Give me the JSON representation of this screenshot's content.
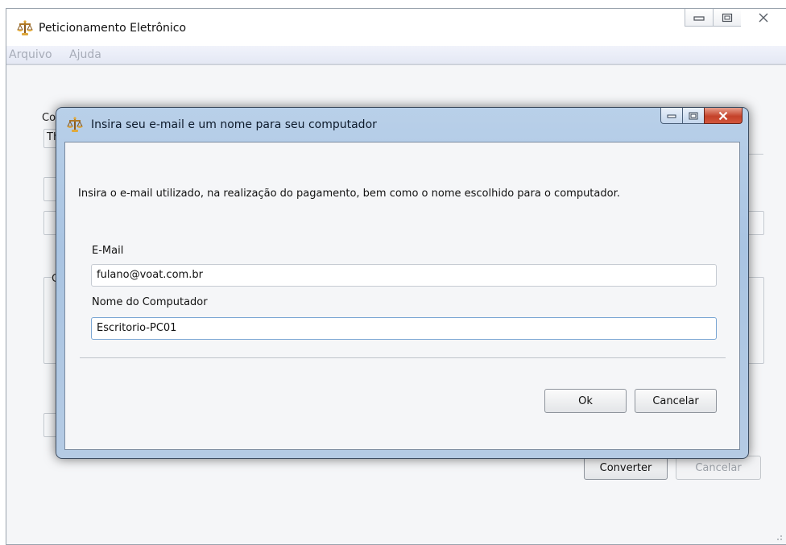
{
  "main_window": {
    "title": "Peticionamento Eletrônico",
    "icon": "scales-of-justice-icon",
    "menu": [
      "Arquivo",
      "Ajuda"
    ],
    "background": {
      "label_fragment": "Co",
      "field_fragment": "Th",
      "group_fragment": "C",
      "convert_label": "Converter",
      "cancel_label": "Cancelar"
    }
  },
  "dialog": {
    "title": "Insira seu e-mail e um nome para seu computador",
    "icon": "scales-of-justice-icon",
    "instruction": "Insira o e-mail utilizado, na realização do pagamento, bem como o nome escolhido para o computador.",
    "email_label": "E-Mail",
    "email_value": "fulano@voat.com.br",
    "computer_label": "Nome do Computador",
    "computer_value": "Escritorio-PC01",
    "ok_label": "Ok",
    "cancel_label": "Cancelar"
  },
  "colors": {
    "dialog_frame": "#a9c4e2",
    "close_button": "#c4422a",
    "focus_border": "#7aa6d3"
  }
}
